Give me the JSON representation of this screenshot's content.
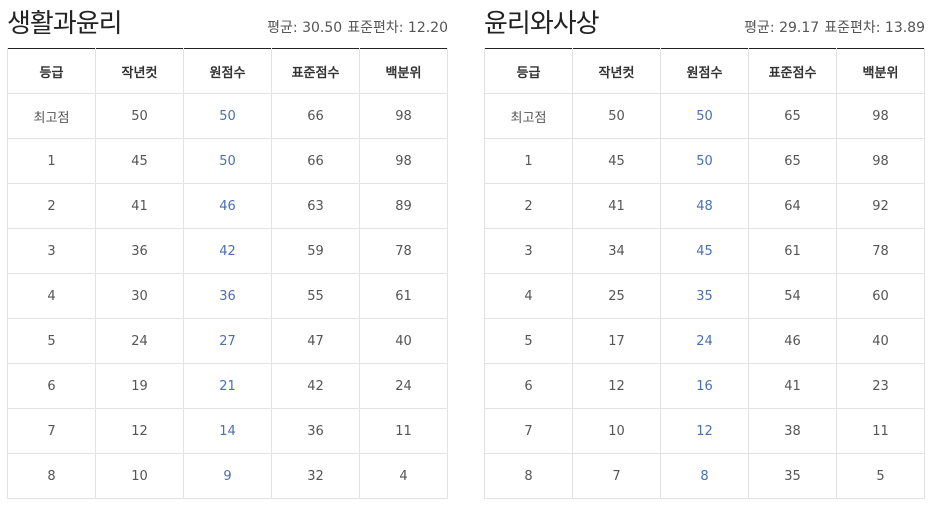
{
  "columns": [
    "등급",
    "작년컷",
    "원점수",
    "표준점수",
    "백분위"
  ],
  "subjects": [
    {
      "title": "생활과윤리",
      "average_label": "평균:",
      "average": "30.50",
      "stddev_label": "표준편차:",
      "stddev": "12.20",
      "rows": [
        {
          "grade": "최고점",
          "last_year": "50",
          "raw": "50",
          "standard": "66",
          "percentile": "98"
        },
        {
          "grade": "1",
          "last_year": "45",
          "raw": "50",
          "standard": "66",
          "percentile": "98"
        },
        {
          "grade": "2",
          "last_year": "41",
          "raw": "46",
          "standard": "63",
          "percentile": "89"
        },
        {
          "grade": "3",
          "last_year": "36",
          "raw": "42",
          "standard": "59",
          "percentile": "78"
        },
        {
          "grade": "4",
          "last_year": "30",
          "raw": "36",
          "standard": "55",
          "percentile": "61"
        },
        {
          "grade": "5",
          "last_year": "24",
          "raw": "27",
          "standard": "47",
          "percentile": "40"
        },
        {
          "grade": "6",
          "last_year": "19",
          "raw": "21",
          "standard": "42",
          "percentile": "24"
        },
        {
          "grade": "7",
          "last_year": "12",
          "raw": "14",
          "standard": "36",
          "percentile": "11"
        },
        {
          "grade": "8",
          "last_year": "10",
          "raw": "9",
          "standard": "32",
          "percentile": "4"
        }
      ]
    },
    {
      "title": "윤리와사상",
      "average_label": "평균:",
      "average": "29.17",
      "stddev_label": "표준편차:",
      "stddev": "13.89",
      "rows": [
        {
          "grade": "최고점",
          "last_year": "50",
          "raw": "50",
          "standard": "65",
          "percentile": "98"
        },
        {
          "grade": "1",
          "last_year": "45",
          "raw": "50",
          "standard": "65",
          "percentile": "98"
        },
        {
          "grade": "2",
          "last_year": "41",
          "raw": "48",
          "standard": "64",
          "percentile": "92"
        },
        {
          "grade": "3",
          "last_year": "34",
          "raw": "45",
          "standard": "61",
          "percentile": "78"
        },
        {
          "grade": "4",
          "last_year": "25",
          "raw": "35",
          "standard": "54",
          "percentile": "60"
        },
        {
          "grade": "5",
          "last_year": "17",
          "raw": "24",
          "standard": "46",
          "percentile": "40"
        },
        {
          "grade": "6",
          "last_year": "12",
          "raw": "16",
          "standard": "41",
          "percentile": "23"
        },
        {
          "grade": "7",
          "last_year": "10",
          "raw": "12",
          "standard": "38",
          "percentile": "11"
        },
        {
          "grade": "8",
          "last_year": "7",
          "raw": "8",
          "standard": "35",
          "percentile": "5"
        }
      ]
    }
  ]
}
